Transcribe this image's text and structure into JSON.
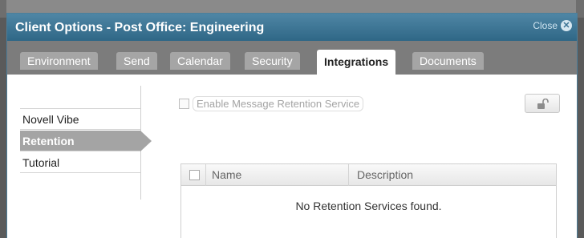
{
  "dialog": {
    "title": "Client Options - Post Office: Engineering",
    "close_label": "Close",
    "close_icon": "close-icon"
  },
  "tabs": [
    {
      "label": "Environment"
    },
    {
      "label": "Send"
    },
    {
      "label": "Calendar"
    },
    {
      "label": "Security"
    },
    {
      "label": "Integrations",
      "active": true
    },
    {
      "label": "Documents"
    }
  ],
  "sidebar": {
    "items": [
      {
        "label": "Novell Vibe"
      },
      {
        "label": "Retention",
        "active": true
      },
      {
        "label": "Tutorial"
      }
    ]
  },
  "retention": {
    "enable_label": "Enable Message Retention Service",
    "enable_checked": false,
    "lock_icon": "unlock-icon"
  },
  "table": {
    "columns": [
      "Name",
      "Description"
    ],
    "empty_message": "No Retention Services found."
  },
  "colors": {
    "titlebar": "#3c7394",
    "tabbar": "#7c7c7c",
    "active_side": "#a4a4a4"
  }
}
